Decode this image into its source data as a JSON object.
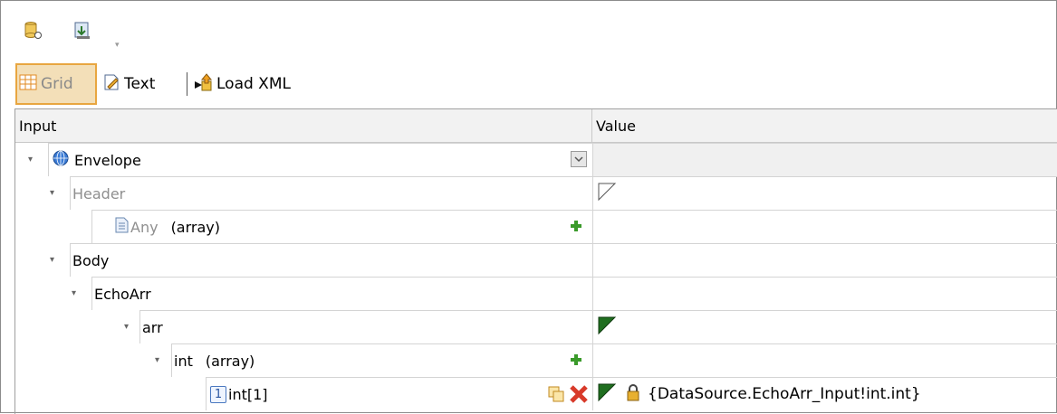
{
  "toolbar": {
    "icons": [
      "db-link-icon",
      "import-icon"
    ],
    "dropdown_glyph": "▾"
  },
  "view": {
    "grid_label": "Grid",
    "text_label": "Text",
    "load_label": "Load XML"
  },
  "table": {
    "headers": {
      "input": "Input",
      "value": "Value"
    },
    "rows": [
      {
        "name": "Envelope",
        "extra": "",
        "value": ""
      },
      {
        "name": "Header",
        "extra": "",
        "value": ""
      },
      {
        "name": "Any",
        "extra": "(array)",
        "value": ""
      },
      {
        "name": "Body",
        "extra": "",
        "value": ""
      },
      {
        "name": "EchoArr",
        "extra": "",
        "value": ""
      },
      {
        "name": "arr",
        "extra": "",
        "value": ""
      },
      {
        "name": "int",
        "extra": "(array)",
        "value": ""
      },
      {
        "name": "int[1]",
        "extra": "",
        "index_badge": "1",
        "value": "{DataSource.EchoArr_Input!int.int}"
      }
    ]
  },
  "colors": {
    "accent_orange": "#e8a640",
    "triangle_green": "#1f6e1f",
    "plus_green": "#3a9a2a",
    "delete_red": "#d83a2a"
  }
}
